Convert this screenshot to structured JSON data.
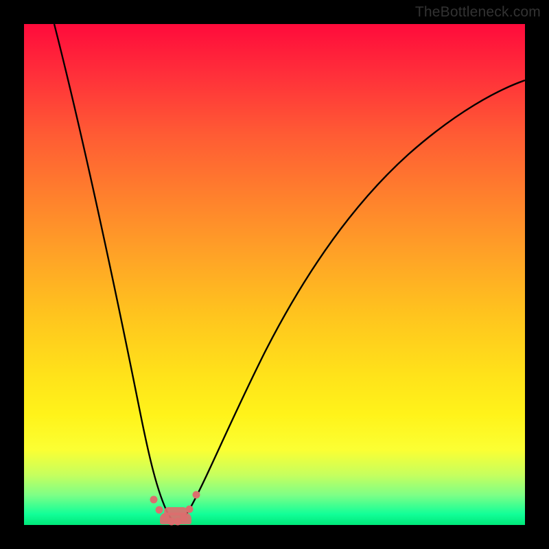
{
  "watermark": "TheBottleneck.com",
  "colors": {
    "frame": "#000000",
    "curve": "#000000",
    "marker": "#db6e6e"
  },
  "chart_data": {
    "type": "line",
    "title": "",
    "xlabel": "",
    "ylabel": "",
    "xlim": [
      0,
      100
    ],
    "ylim": [
      0,
      100
    ],
    "grid": false,
    "legend": false,
    "annotations": [],
    "series": [
      {
        "name": "bottleneck-curve",
        "x": [
          0,
          5,
          10,
          15,
          20,
          23,
          26,
          28,
          30,
          32,
          35,
          40,
          45,
          50,
          55,
          60,
          65,
          70,
          75,
          80,
          85,
          90,
          95,
          100
        ],
        "y": [
          100,
          80,
          60,
          41,
          22,
          12,
          5,
          1.5,
          0.5,
          1.5,
          6,
          20,
          32,
          42,
          50,
          57,
          63,
          68,
          72.5,
          76.5,
          80,
          83,
          85.5,
          88
        ]
      }
    ],
    "marked_region": {
      "x_start": 26,
      "x_end": 32,
      "y_start": 0,
      "y_end": 5
    },
    "marked_points": [
      {
        "x": 25.5,
        "y": 5.5
      },
      {
        "x": 26.5,
        "y": 3.0
      },
      {
        "x": 28.0,
        "y": 1.5
      },
      {
        "x": 29.0,
        "y": 0.8
      },
      {
        "x": 30.0,
        "y": 0.8
      },
      {
        "x": 31.0,
        "y": 1.5
      },
      {
        "x": 32.0,
        "y": 3.0
      },
      {
        "x": 33.5,
        "y": 6.5
      }
    ],
    "background": "vertical-gradient red→orange→yellow→green"
  }
}
